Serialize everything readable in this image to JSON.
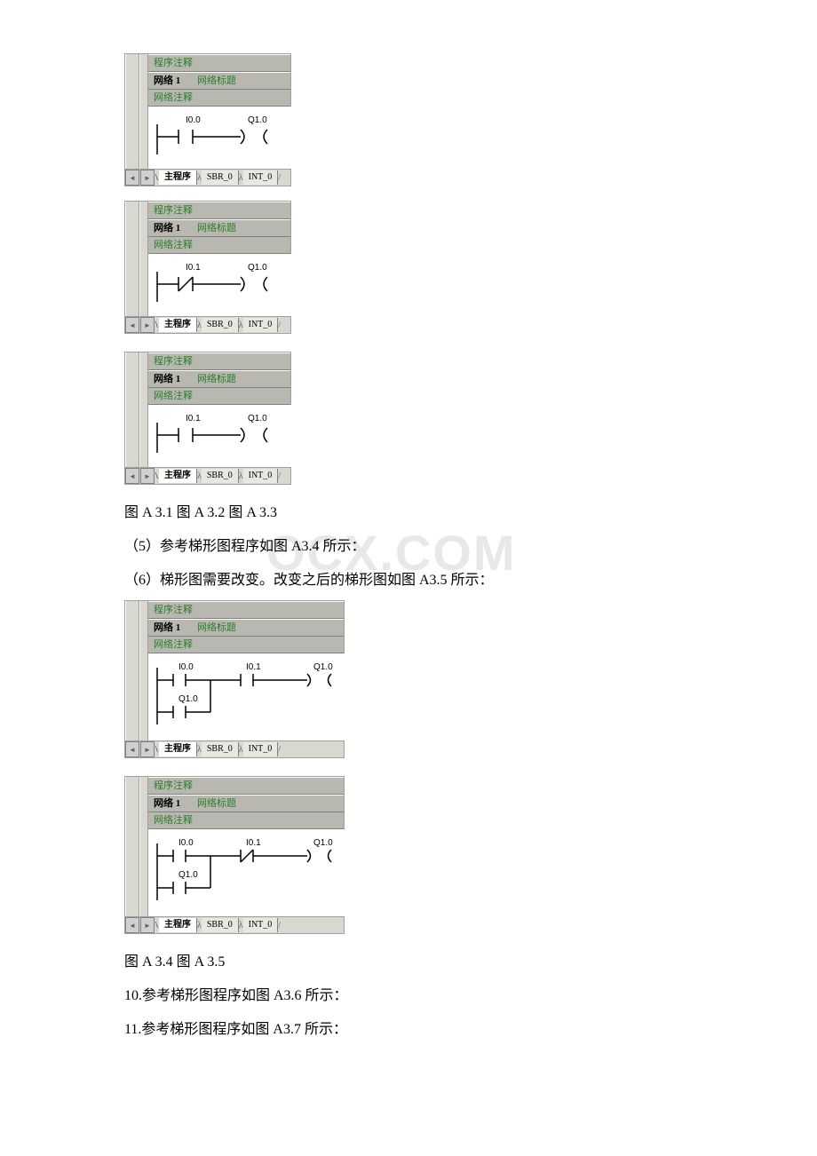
{
  "ladder_common": {
    "program_comment": "程序注释",
    "network_label": "网络 1",
    "network_title": "网络标题",
    "network_comment": "网络注释",
    "tab_main": "主程序",
    "tab_sbr": "SBR_0",
    "tab_int": "INT_0"
  },
  "ladder1": {
    "contact1": "I0.0",
    "coil": "Q1.0"
  },
  "ladder2": {
    "contact1": "I0.1",
    "coil": "Q1.0"
  },
  "ladder3": {
    "contact1": "I0.1",
    "coil": "Q1.0"
  },
  "ladder4": {
    "contact1": "I0.0",
    "contact2": "I0.1",
    "coil": "Q1.0",
    "branch": "Q1.0"
  },
  "ladder5": {
    "contact1": "I0.0",
    "contact2": "I0.1",
    "coil": "Q1.0",
    "branch": "Q1.0"
  },
  "text": {
    "caption1": "图 A 3.1 图 A 3.2 图 A 3.3",
    "line5": "（5）参考梯形图程序如图 A3.4 所示：",
    "line6": "（6）梯形图需要改变。改变之后的梯形图如图 A3.5 所示：",
    "caption2": "图 A 3.4 图 A 3.5",
    "line10": "10.参考梯形图程序如图 A3.6 所示：",
    "line11": "11.参考梯形图程序如图 A3.7 所示："
  },
  "watermark": "OCX.COM"
}
